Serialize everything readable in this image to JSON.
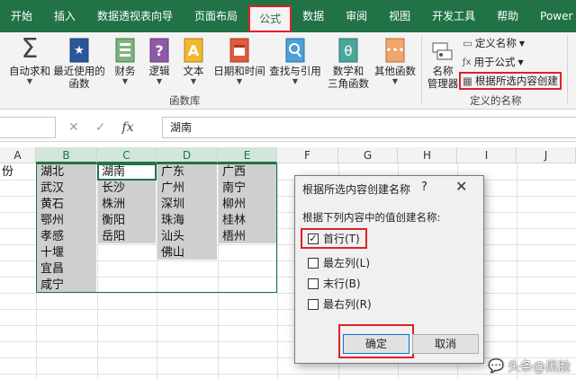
{
  "tabs": [
    "开始",
    "插入",
    "数据透视表向导",
    "页面布局",
    "公式",
    "数据",
    "审阅",
    "视图",
    "开发工具",
    "帮助",
    "Power Piv"
  ],
  "ribbon": {
    "autosum": "自动求和",
    "recent1": "最近使用的",
    "recent2": "函数",
    "finance": "财务",
    "logic": "逻辑",
    "text": "文本",
    "datetime": "日期和时间",
    "lookup": "查找与引用",
    "math1": "数学和",
    "math2": "三角函数",
    "other": "其他函数",
    "group_funclib": "函数库",
    "namemgr1": "名称",
    "namemgr2": "管理器",
    "define_name": "定义名称",
    "use_in_formula": "用于公式",
    "create_from_sel": "根据所选内容创建",
    "group_definednames": "定义的名称"
  },
  "formula_bar": {
    "cancel": "✕",
    "confirm": "✓",
    "fx": "fx",
    "value": "湖南"
  },
  "columns": [
    "A",
    "B",
    "C",
    "D",
    "E",
    "F",
    "G",
    "H",
    "I",
    "J"
  ],
  "cells": {
    "a_partial": "份",
    "colB": [
      "湖北",
      "武汉",
      "黄石",
      "鄂州",
      "孝感",
      "十堰",
      "宜昌",
      "咸宁"
    ],
    "colC": [
      "湖南",
      "长沙",
      "株洲",
      "衡阳",
      "岳阳"
    ],
    "colD": [
      "广东",
      "广州",
      "深圳",
      "珠海",
      "汕头",
      "佛山"
    ],
    "colE": [
      "广西",
      "南宁",
      "柳州",
      "桂林",
      "梧州"
    ]
  },
  "dialog": {
    "title": "根据所选内容创建名称",
    "help": "?",
    "close": "✕",
    "prompt": "根据下列内容中的值创建名称:",
    "options": [
      {
        "label": "首行(T)",
        "checked": true
      },
      {
        "label": "最左列(L)",
        "checked": false
      },
      {
        "label": "末行(B)",
        "checked": false
      },
      {
        "label": "最右列(R)",
        "checked": false
      }
    ],
    "ok": "确定",
    "cancel": "取消"
  },
  "watermark": "头条@黑脸"
}
